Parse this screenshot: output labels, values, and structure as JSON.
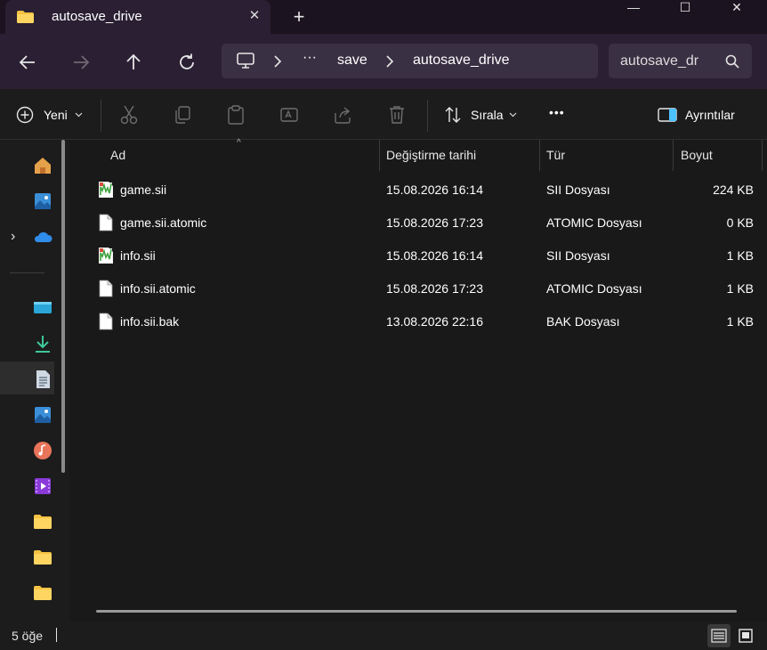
{
  "window": {
    "tab_title": "autosave_drive",
    "close_tab_glyph": "✕",
    "new_tab_glyph": "+",
    "minimize_glyph": "—",
    "maximize_glyph": "☐",
    "close_glyph": "✕"
  },
  "address": {
    "ellipsis": "···",
    "crumbs": [
      "save",
      "autosave_drive"
    ]
  },
  "search": {
    "placeholder": "autosave_dr"
  },
  "toolbar": {
    "new_label": "Yeni",
    "sort_label": "Sırala",
    "more_glyph": "•••",
    "details_label": "Ayrıntılar"
  },
  "columns": {
    "name": "Ad",
    "modified": "Değiştirme tarihi",
    "type": "Tür",
    "size": "Boyut"
  },
  "files": [
    {
      "name": "game.sii",
      "modified": "15.08.2026 16:14",
      "type": "SII Dosyası",
      "size": "224 KB",
      "icon": "sii-file-icon"
    },
    {
      "name": "game.sii.atomic",
      "modified": "15.08.2026 17:23",
      "type": "ATOMIC Dosyası",
      "size": "0 KB",
      "icon": "generic-file-icon"
    },
    {
      "name": "info.sii",
      "modified": "15.08.2026 16:14",
      "type": "SII Dosyası",
      "size": "1 KB",
      "icon": "sii-file-icon"
    },
    {
      "name": "info.sii.atomic",
      "modified": "15.08.2026 17:23",
      "type": "ATOMIC Dosyası",
      "size": "1 KB",
      "icon": "generic-file-icon"
    },
    {
      "name": "info.sii.bak",
      "modified": "13.08.2026 22:16",
      "type": "BAK Dosyası",
      "size": "1 KB",
      "icon": "generic-file-icon"
    }
  ],
  "status": {
    "count": "5 öğe"
  },
  "colors": {
    "titlebar": "#1c1320",
    "navbar": "#2a1f33",
    "accent": "#4cc2ff"
  }
}
